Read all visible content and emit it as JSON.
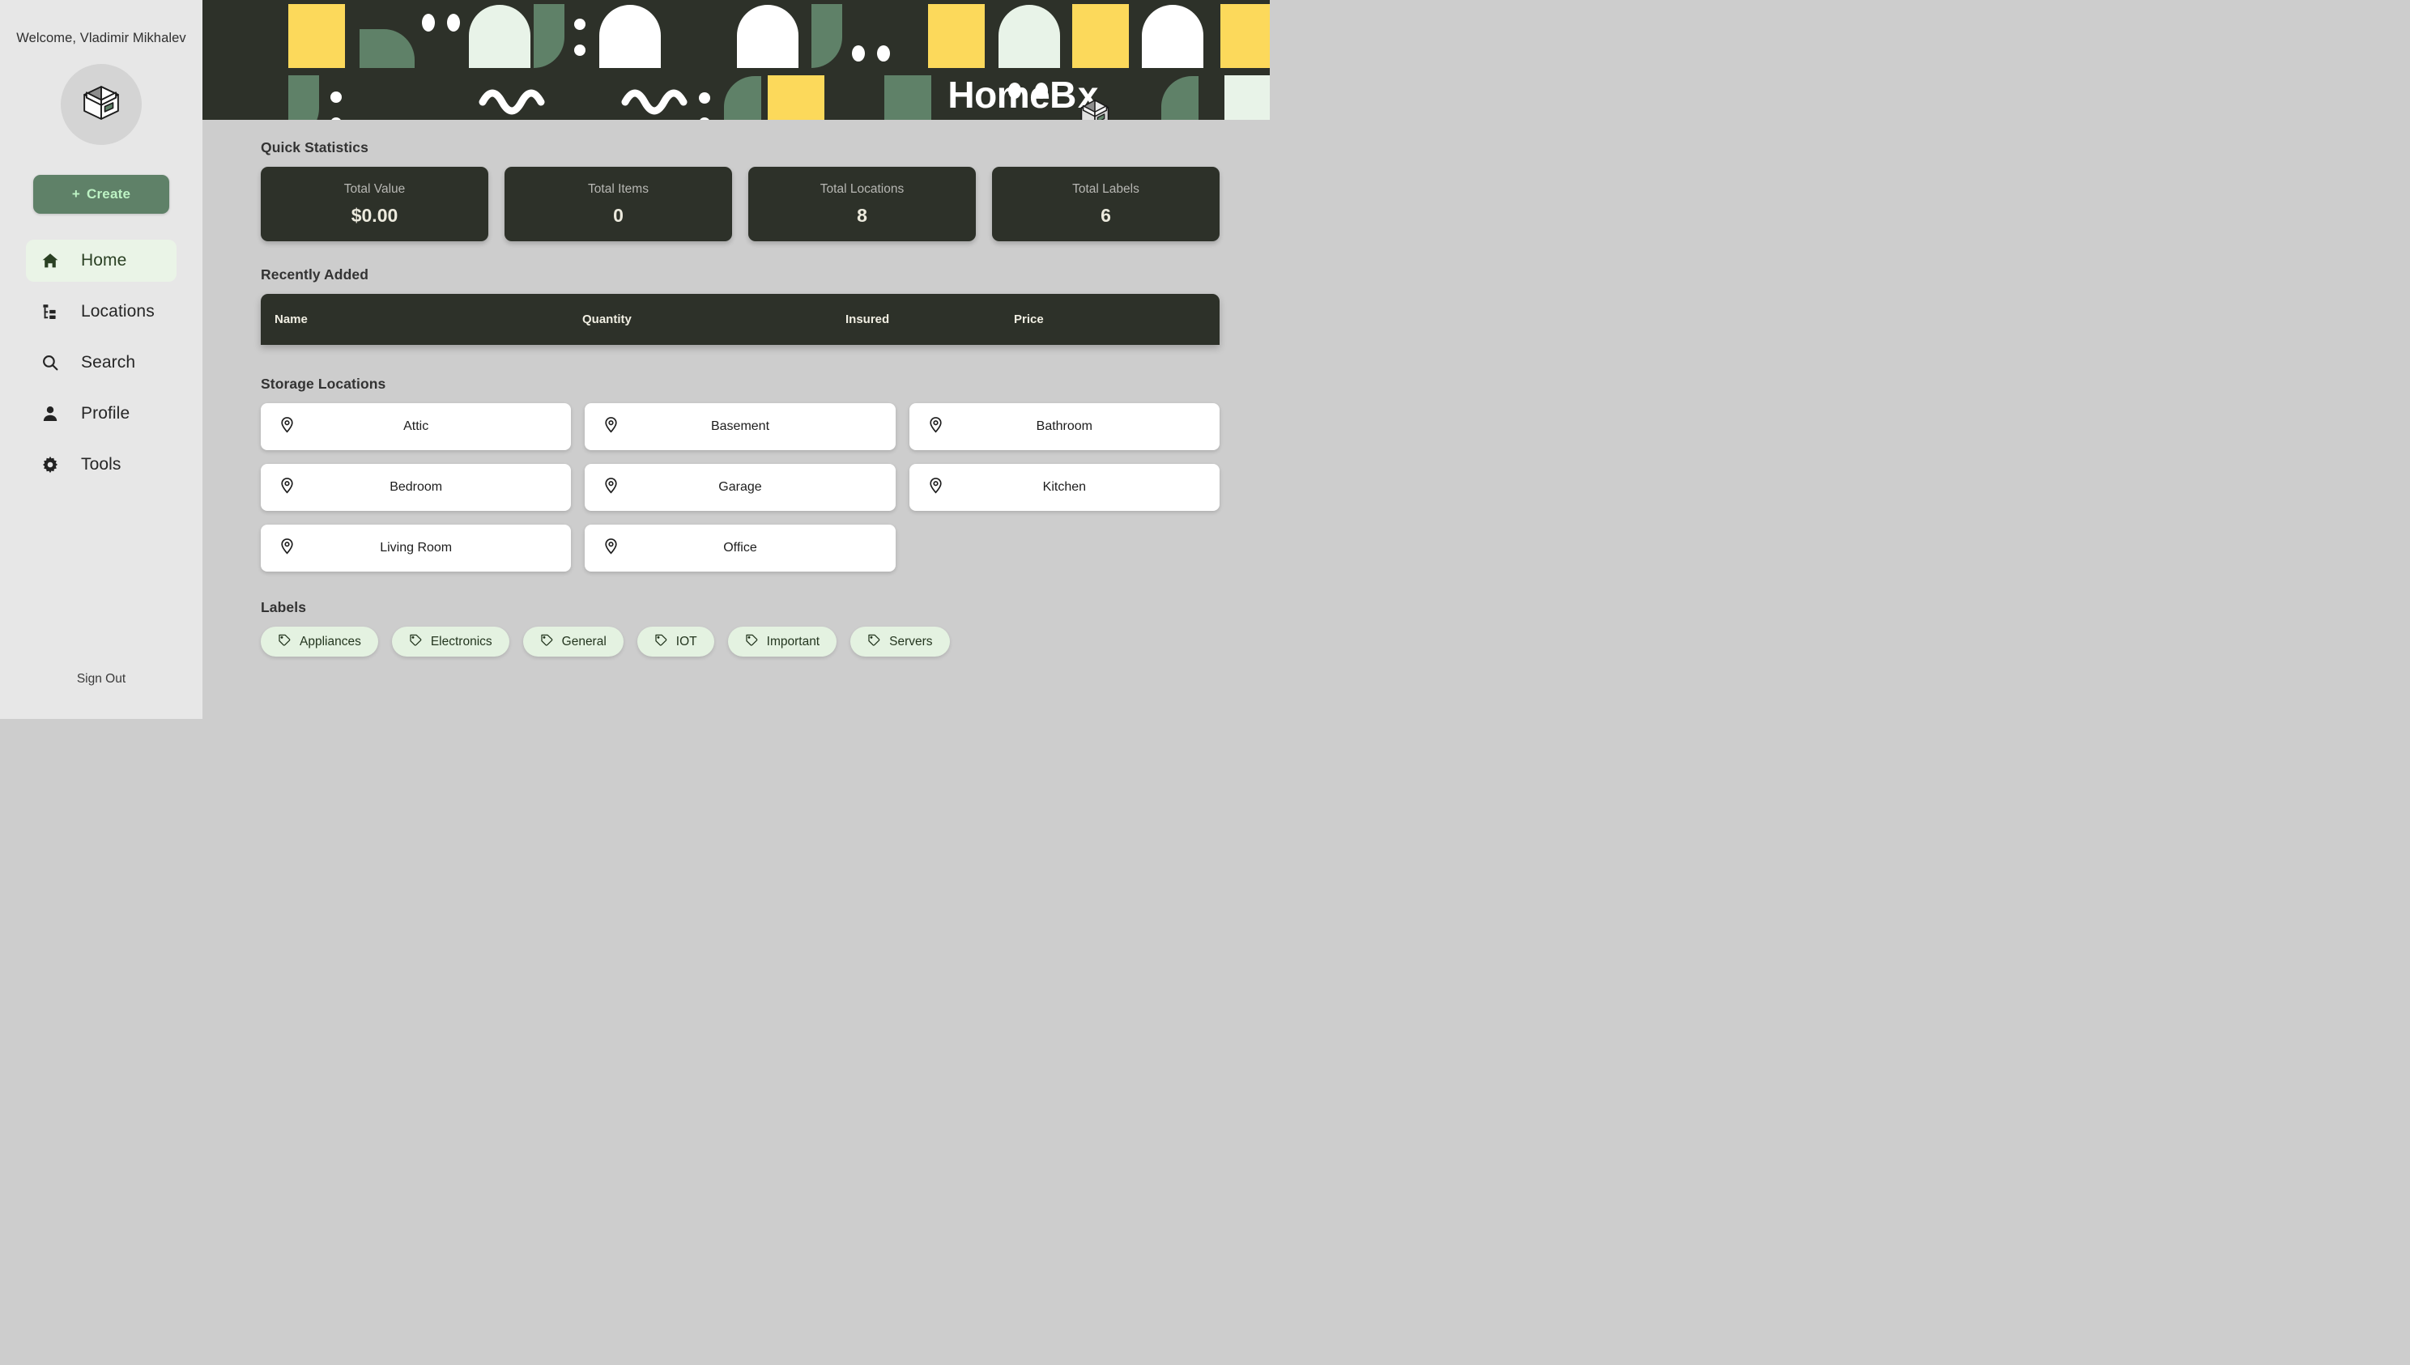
{
  "sidebar": {
    "welcome": "Welcome, Vladimir Mikhalev",
    "avatar_icon": "box-icon",
    "create_label": "Create",
    "create_plus": "+",
    "nav_items": [
      {
        "label": "Home",
        "icon": "home-icon",
        "active": true
      },
      {
        "label": "Locations",
        "icon": "tree-icon",
        "active": false
      },
      {
        "label": "Search",
        "icon": "search-icon",
        "active": false
      },
      {
        "label": "Profile",
        "icon": "person-icon",
        "active": false
      },
      {
        "label": "Tools",
        "icon": "gear-icon",
        "active": false
      }
    ],
    "sign_out": "Sign Out"
  },
  "header": {
    "logo_before": "HomeB",
    "logo_after": "x",
    "logo_icon": "box-icon",
    "background": "#2d3129",
    "pattern_colors": {
      "yellow": "#fcd95b",
      "green": "#5f8168",
      "white": "#ffffff",
      "mint": "#e8f3e8"
    }
  },
  "main": {
    "quick_statistics": {
      "title": "Quick Statistics",
      "cards": [
        {
          "label": "Total Value",
          "value": "$0.00"
        },
        {
          "label": "Total Items",
          "value": "0"
        },
        {
          "label": "Total Locations",
          "value": "8"
        },
        {
          "label": "Total Labels",
          "value": "6"
        }
      ]
    },
    "recently_added": {
      "title": "Recently Added",
      "columns": [
        "Name",
        "Quantity",
        "Insured",
        "Price"
      ],
      "rows": []
    },
    "storage_locations": {
      "title": "Storage Locations",
      "icon": "map-pin-icon",
      "items": [
        {
          "name": "Attic"
        },
        {
          "name": "Basement"
        },
        {
          "name": "Bathroom"
        },
        {
          "name": "Bedroom"
        },
        {
          "name": "Garage"
        },
        {
          "name": "Kitchen"
        },
        {
          "name": "Living Room"
        },
        {
          "name": "Office"
        }
      ]
    },
    "labels": {
      "title": "Labels",
      "icon": "tag-icon",
      "items": [
        {
          "name": "Appliances"
        },
        {
          "name": "Electronics"
        },
        {
          "name": "General"
        },
        {
          "name": "IOT"
        },
        {
          "name": "Important"
        },
        {
          "name": "Servers"
        }
      ]
    }
  },
  "theme": {
    "accent_green": "#5f8168",
    "dark": "#2d3129",
    "page_bg": "#cdcdcd",
    "sidebar_bg": "#e7e7e7",
    "active_nav_bg": "#eaf4e7",
    "chip_bg": "#e4f2e1"
  }
}
